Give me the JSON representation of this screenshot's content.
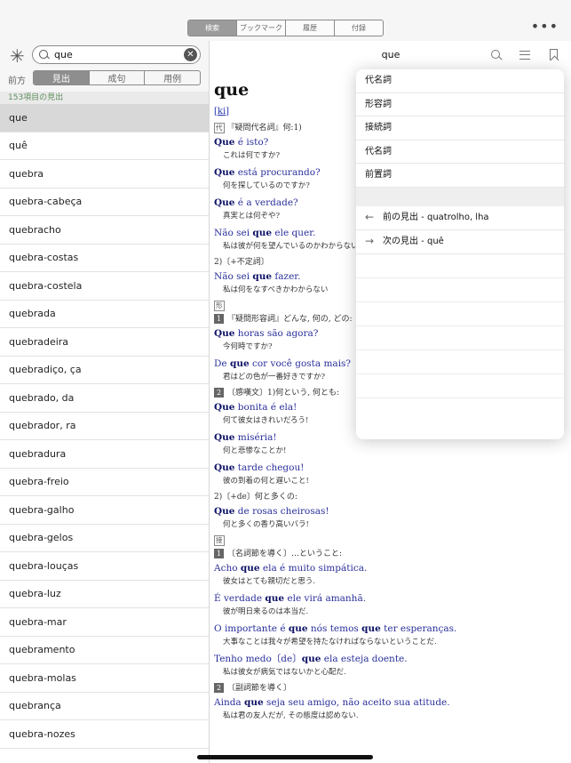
{
  "tabs": {
    "items": [
      "検索",
      "ブックマーク",
      "履歴",
      "付録"
    ],
    "active": 0
  },
  "more_icon": "more-dots-icon",
  "search": {
    "query": "que",
    "asterisk_icon": "asterisk-icon",
    "clear_icon": "clear-icon"
  },
  "match_mode": {
    "label": "前方",
    "options": [
      "見出",
      "成句",
      "用例"
    ],
    "active": 0
  },
  "results": {
    "count_label": "153項目の見出",
    "items": [
      "que",
      "quê",
      "quebra",
      "quebra-cabeça",
      "quebracho",
      "quebra-costas",
      "quebra-costela",
      "quebrada",
      "quebradeira",
      "quebradiço, ça",
      "quebrado, da",
      "quebrador, ra",
      "quebradura",
      "quebra-freio",
      "quebra-galho",
      "quebra-gelos",
      "quebra-louças",
      "quebra-luz",
      "quebra-mar",
      "quebramento",
      "quebra-molas",
      "quebrança",
      "quebra-nozes"
    ],
    "selected": 0
  },
  "entry": {
    "nav_title": "que",
    "headword": "que",
    "pronunciation": "ki",
    "pos_pron": "代",
    "pos_adj": "形",
    "pos_conj": "接",
    "sense_pron_1": "『疑問代名詞』何:1)",
    "ex1": "Que é isto?",
    "tr1": "これは何ですか?",
    "ex2": "Que está procurando?",
    "tr2": "何を探しているのですか?",
    "ex3": "Que é a verdade?",
    "tr3": "真実とは何ぞや?",
    "ex4": "Não sei que ele quer.",
    "tr4": "私は彼が何を望んでいるのかわからない",
    "sense_pron_2": "2)〔+不定詞〕",
    "ex5": "Não sei que fazer.",
    "tr5": "私は何をなすべきかわからない",
    "sense_adj_1_num": "1",
    "sense_adj_1": "『疑問形容詞』どんな, 何の, どの:",
    "ex6": "Que horas são agora?",
    "tr6": "今何時ですか?",
    "ex7": "De que cor você gosta mais?",
    "tr7": "君はどの色が一番好きですか?",
    "sense_adj_2_num": "2",
    "sense_adj_2": "〔感嘆文〕1)何という, 何とも:",
    "ex8": "Que bonita é ela!",
    "tr8": "何て彼女はきれいだろう!",
    "ex9": "Que miséria!",
    "tr9": "何と悲惨なことか!",
    "ex10": "Que tarde chegou!",
    "tr10": "彼の到着の何と遅いこと!",
    "sense_adj_3": "2)〔+de〕何と多くの:",
    "ex11": "Que de rosas cheirosas!",
    "tr11": "何と多くの香り高いバラ!",
    "sense_conj_1_num": "1",
    "sense_conj_1": "〔名詞節を導く〕…ということ:",
    "ex12": "Acho que ela é muito simpática.",
    "tr12": "彼女はとても親切だと思う.",
    "ex13": "É verdade que ele virá amanhã.",
    "tr13": "彼が明日来るのは本当だ.",
    "ex14": "O importante é que nós temos que ter esperanças.",
    "tr14": "大事なことは我々が希望を持たなければならないということだ.",
    "ex15": "Tenho medo〔de〕que ela esteja doente.",
    "tr15": "私は彼女が病気ではないかと心配だ.",
    "sense_conj_2_num": "2",
    "sense_conj_2": "〔副詞節を導く〕",
    "ex16": "Ainda que seja seu amigo, não aceito sua atitude.",
    "tr16": "私は君の友人だが, その態度は認めない."
  },
  "popover": {
    "sections": [
      "代名詞",
      "形容詞",
      "接続詞",
      "代名詞",
      "前置詞"
    ],
    "prev_label": "前の見出 - quatrolho, lha",
    "next_label": "次の見出 - quê",
    "prev_icon": "arrow-left-icon",
    "next_icon": "arrow-right-icon"
  },
  "toolbar_icons": [
    "search-icon",
    "list-icon",
    "bookmark-icon"
  ]
}
